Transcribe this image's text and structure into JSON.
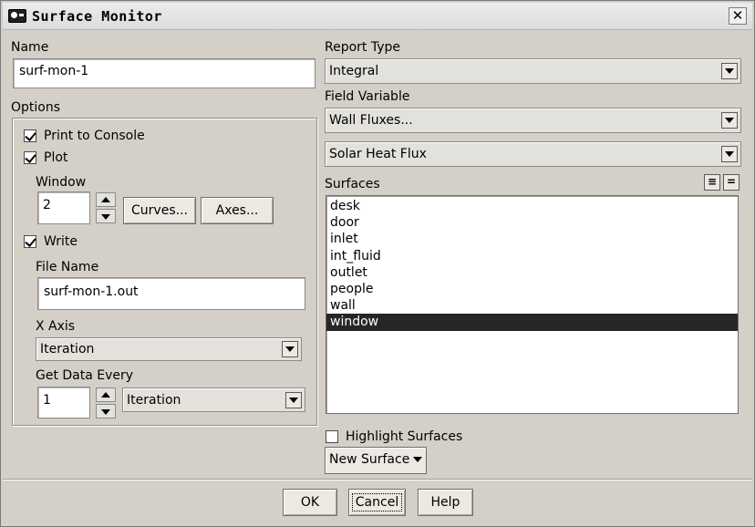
{
  "window": {
    "title": "Surface Monitor",
    "close_glyph": "✕"
  },
  "name": {
    "label": "Name",
    "value": "surf-mon-1"
  },
  "options": {
    "label": "Options",
    "print_to_console": {
      "label": "Print to Console",
      "checked": true
    },
    "plot": {
      "label": "Plot",
      "checked": true
    },
    "window_label": "Window",
    "window_value": "2",
    "curves_button": "Curves...",
    "axes_button": "Axes...",
    "write": {
      "label": "Write",
      "checked": true
    },
    "file_name_label": "File Name",
    "file_name_value": "surf-mon-1.out",
    "x_axis_label": "X Axis",
    "x_axis_value": "Iteration",
    "get_data_every_label": "Get Data Every",
    "get_data_every_value": "1",
    "get_data_every_unit": "Iteration"
  },
  "report_type": {
    "label": "Report Type",
    "value": "Integral"
  },
  "field_variable": {
    "label": "Field Variable",
    "category": "Wall Fluxes...",
    "value": "Solar Heat Flux"
  },
  "surfaces": {
    "label": "Surfaces",
    "items": [
      "desk",
      "door",
      "inlet",
      "int_fluid",
      "outlet",
      "people",
      "wall",
      "window"
    ],
    "selected": [
      "window"
    ]
  },
  "highlight_surfaces": {
    "label": "Highlight Surfaces",
    "checked": false
  },
  "new_surface_button": "New Surface",
  "footer": {
    "ok": "OK",
    "cancel": "Cancel",
    "help": "Help"
  }
}
